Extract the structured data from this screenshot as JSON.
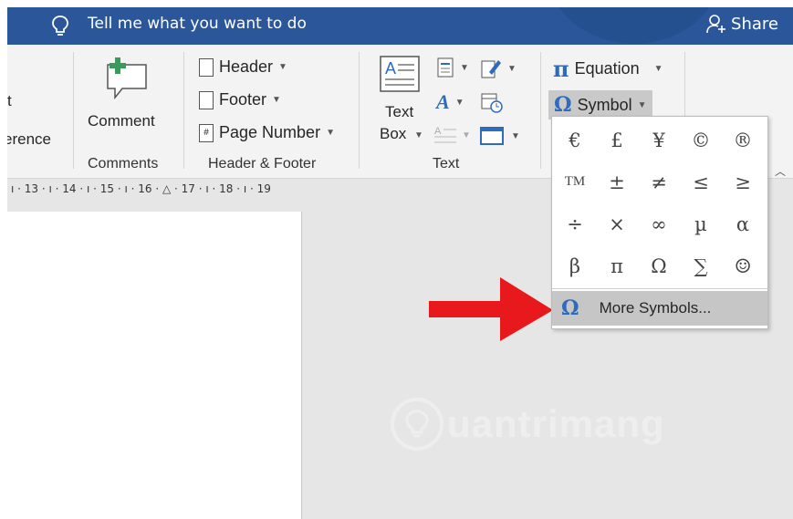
{
  "titlebar": {
    "tell_me": "Tell me what you want to do",
    "share": "Share"
  },
  "ribbon": {
    "partial_label_top": "t",
    "partial_label": "erence",
    "comment": "Comment",
    "comments_group": "Comments",
    "header": "Header",
    "footer": "Footer",
    "page_number": "Page Number",
    "header_footer_group": "Header & Footer",
    "text_box_line1": "Text",
    "text_box_line2": "Box",
    "text_group": "Text",
    "equation_symbol": "π",
    "equation": "Equation",
    "symbol_glyph": "Ω",
    "symbol": "Symbol"
  },
  "ruler": {
    "ticks": "ı · 13 · ı · 14 · ı · 15 · ı · 16 · △ · 17 · ı · 18 · ı · 19"
  },
  "symbols": {
    "rows": [
      [
        "€",
        "£",
        "¥",
        "©",
        "®"
      ],
      [
        "TM",
        "±",
        "≠",
        "≤",
        "≥"
      ],
      [
        "÷",
        "×",
        "∞",
        "µ",
        "α"
      ],
      [
        "β",
        "π",
        "Ω",
        "∑",
        "☺"
      ]
    ],
    "more_glyph": "Ω",
    "more_label": "More Symbols..."
  },
  "watermark": {
    "text": "uantrimang"
  },
  "colors": {
    "titlebar": "#2b579a",
    "accent_blue": "#2f6bbd",
    "arrow_red": "#e8191c",
    "highlight": "#c6c6c6"
  }
}
